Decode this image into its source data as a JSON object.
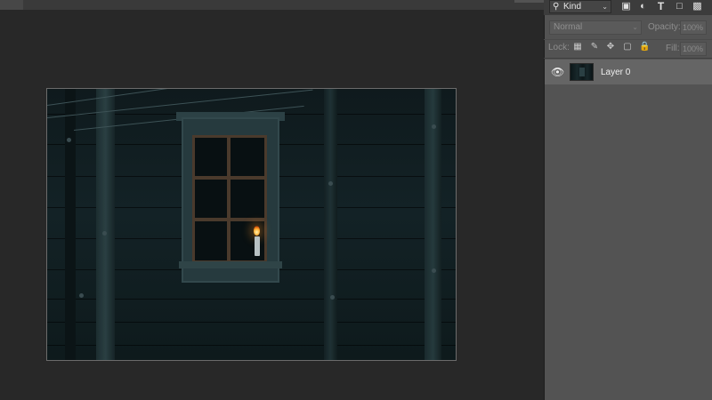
{
  "panel": {
    "filter": {
      "kind_label": "Kind",
      "icons": [
        "image-filter-icon",
        "adjustment-filter-icon",
        "type-filter-icon",
        "shape-filter-icon",
        "smart-object-filter-icon"
      ]
    },
    "blend_mode": "Normal",
    "opacity_label": "Opacity:",
    "opacity_value": "100%",
    "lock_label": "Lock:",
    "lock_icons": [
      "lock-transparent-icon",
      "lock-image-icon",
      "lock-position-icon",
      "lock-artboard-icon",
      "lock-all-icon"
    ],
    "fill_label": "Fill:",
    "fill_value": "100%",
    "layers": [
      {
        "name": "Layer 0",
        "visible": true,
        "selected": true
      }
    ]
  }
}
